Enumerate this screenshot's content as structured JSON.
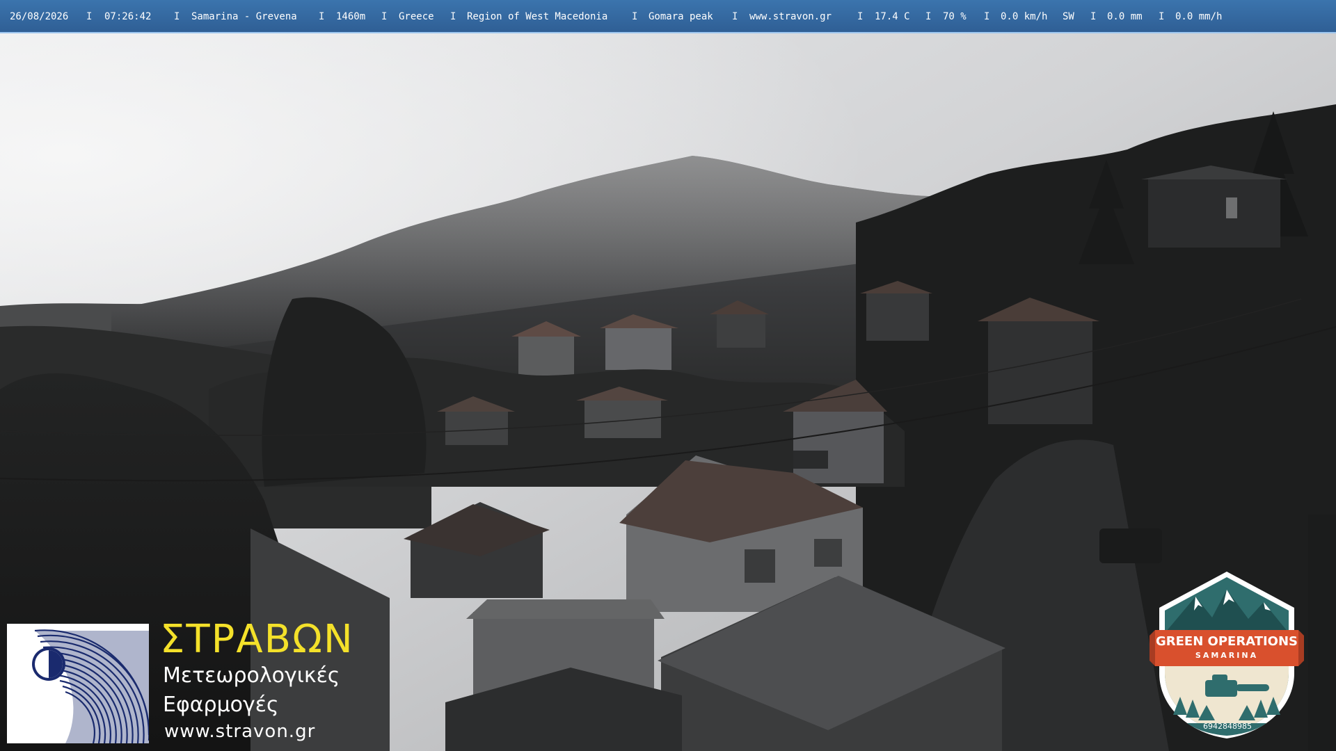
{
  "info_bar": {
    "date": "26/08/2026",
    "time": "07:26:42",
    "location": "Samarina - Grevena",
    "altitude": "1460m",
    "country": "Greece",
    "region": "Region of West Macedonia",
    "view": "Gomara peak",
    "website": "www.stravon.gr",
    "temperature": "17.4 C",
    "humidity": "70 %",
    "wind_speed": "0.0 km/h",
    "wind_direction": "SW",
    "rain_total": "0.0 mm",
    "rain_rate": "0.0 mm/h",
    "separator": "I"
  },
  "stravon_logo": {
    "title": "ΣΤΡΑΒΩΝ",
    "line1": "Μετεωρολογικές",
    "line2": "Εφαρμογές",
    "url": "www.stravon.gr"
  },
  "green_operations_badge": {
    "title": "GREEN OPERATIONS",
    "subtitle": "SAMARINA",
    "phone": "6942848985"
  },
  "colors": {
    "bar_blue": "#3b74ad",
    "logo_yellow": "#f4e12a",
    "logo_navy": "#1a2a6e",
    "badge_red": "#d9502d",
    "badge_teal": "#2f6d6d"
  }
}
